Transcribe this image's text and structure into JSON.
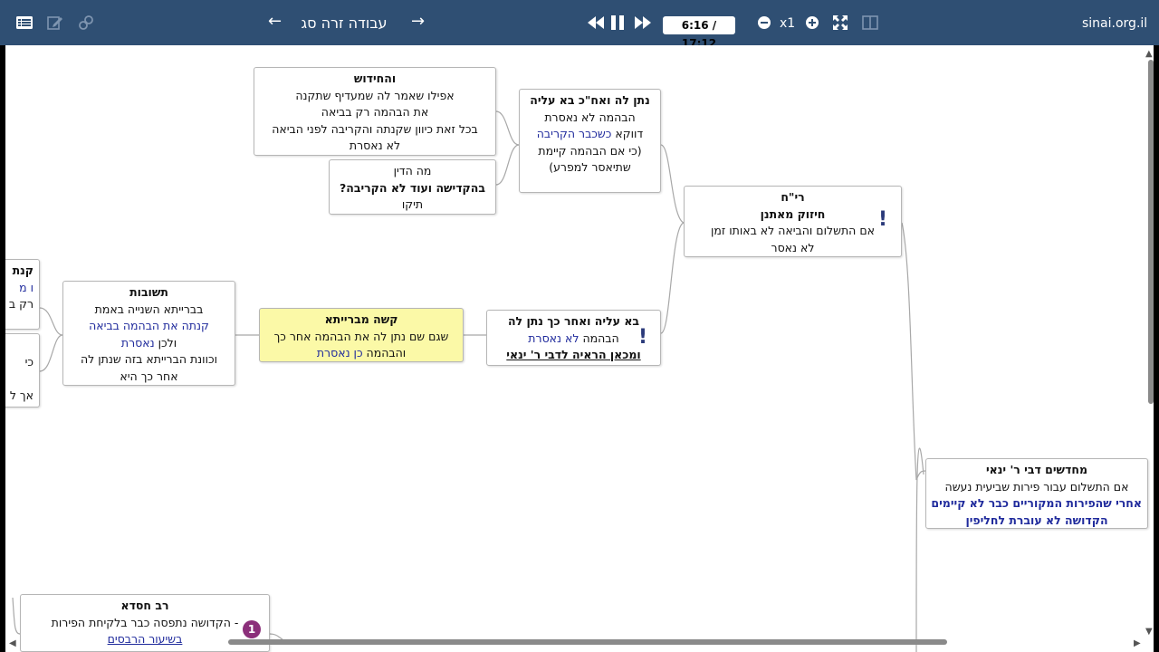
{
  "toolbar": {
    "lesson_title": "עבודה זרה סג",
    "prev_arrow": "←",
    "next_arrow": "→",
    "time": "6:16 / 17:12",
    "speed": "x1",
    "site": "sinai.org.il"
  },
  "nodes": {
    "chiddush": {
      "title": "והחידוש",
      "l1": "אפילו שאמר לה שמעדיף שתקנה",
      "l2": "את הבהמה רק בביאה",
      "l3": "בכל זאת כיוון שקנתה והקריבה לפני הביאה",
      "l4": "לא נאסרת"
    },
    "mah_hadin": {
      "l1": "מה הדין",
      "l2": "בהקדישה ועוד לא הקריבה?",
      "l3": "תיקו"
    },
    "natan_ba": {
      "title": "נתן לה ואח\"כ בא עליה",
      "l1": "הבהמה לא נאסרת",
      "l2a": "דווקא ",
      "l2b": "כשכבר הקריבה",
      "l3": "(כי אם הבהמה קיימת",
      "l4": "שתיאסר למפרע)"
    },
    "rich": {
      "title": "רי\"ח",
      "sub": "חיזוק מאתנן",
      "l1": "אם התשלום והביאה לא באותו זמן",
      "l2": "לא נאסר"
    },
    "teshuvot": {
      "title": "תשובות",
      "l1": "בברייתא השנייה באמת",
      "l2": "קנתה את הבהמה בביאה",
      "l3a": "ולכן ",
      "l3b": "נאסרת",
      "l4": "וכוונת הברייתא בזה שנתן לה",
      "l5": "אחר כך היא"
    },
    "kasha": {
      "title": "קשה מברייתא",
      "l1": "שגם שם נתן לה את הבהמה אחר כך",
      "l2a": "והבהמה ",
      "l2b": "כן נאסרת"
    },
    "ba_natan": {
      "title": "בא עליה ואחר כך נתן לה",
      "l1a": "הבהמה ",
      "l1b": "לא נאסרת",
      "l2": "ומכאן הראיה לדבי ר' ינאי"
    },
    "mechadshim": {
      "title": "מחדשים דבי ר' ינאי",
      "l1": "אם התשלום עבור פירות שביעית נעשה",
      "l2": "אחרי שהפירות המקוריים כבר לא קיימים",
      "l3": "הקדושה לא עוברת לחליפין"
    },
    "rav_chisda": {
      "title": "רב חסדא",
      "l1": "- הקדושה נתפסה כבר בלקיחת הפירות",
      "l2": "בשיעור הרבסים"
    },
    "edge_a": {
      "l1": "קנת",
      "l2": "ו מ",
      "l3": "רק ב"
    },
    "edge_b": {
      "l1": "כי",
      "l2": "אך ל"
    },
    "bang": "!",
    "badge": "1"
  }
}
